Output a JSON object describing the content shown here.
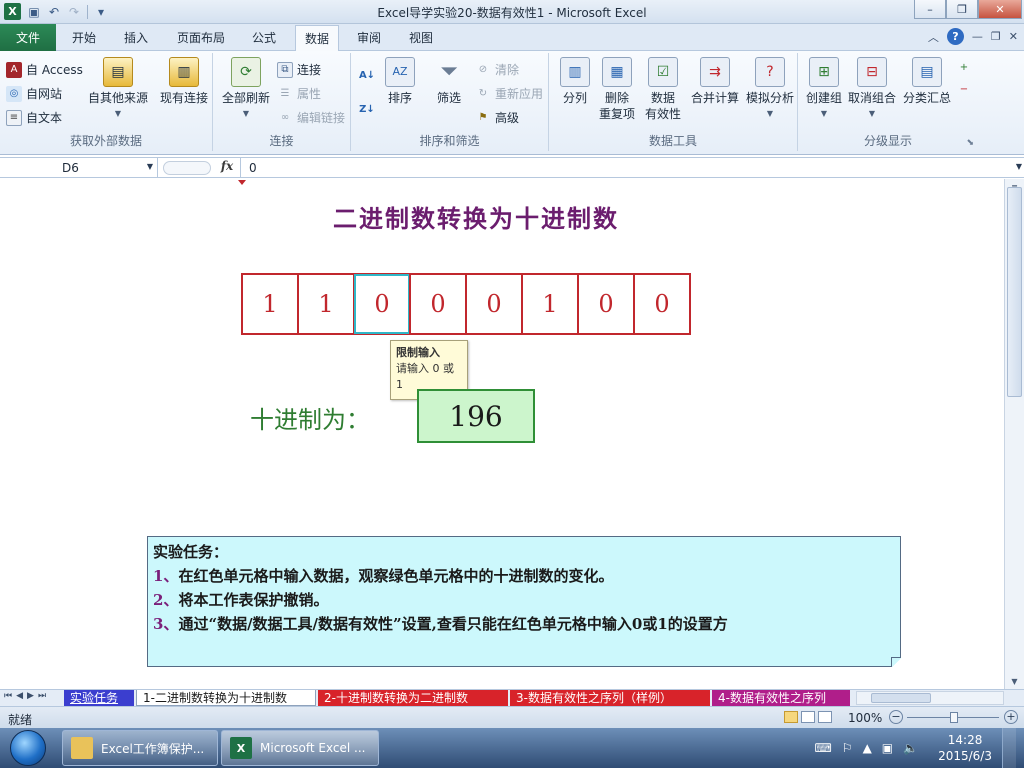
{
  "window": {
    "title": "Excel导学实验20-数据有效性1  -  Microsoft Excel",
    "controls": {
      "minimize": "–",
      "restore": "❐",
      "close": "✕"
    }
  },
  "qat": {
    "logo": "X",
    "save": "▣",
    "undo": "↶",
    "redo": "↷",
    "customize": "▾"
  },
  "tabs": {
    "file": "文件",
    "items": [
      "开始",
      "插入",
      "页面布局",
      "公式",
      "数据",
      "审阅",
      "视图"
    ],
    "active": "数据"
  },
  "ribbon": {
    "external": {
      "label": "获取外部数据",
      "access": "自 Access",
      "web": "自网站",
      "text": "自文本",
      "other": "自其他来源",
      "existing": "现有连接"
    },
    "connections": {
      "label": "连接",
      "refresh_all": "全部刷新",
      "connect": "连接",
      "properties": "属性",
      "edit_links": "编辑链接"
    },
    "sort_filter": {
      "label": "排序和筛选",
      "sort": "排序",
      "filter": "筛选",
      "clear": "清除",
      "reapply": "重新应用",
      "advanced": "高级"
    },
    "data_tools": {
      "label": "数据工具",
      "text_to_columns": "分列",
      "remove_dup_1": "删除",
      "remove_dup_2": "重复项",
      "validation_1": "数据",
      "validation_2": "有效性",
      "consolidate": "合并计算",
      "what_if": "模拟分析"
    },
    "outline": {
      "label": "分级显示",
      "group": "创建组",
      "ungroup": "取消组合",
      "subtotal": "分类汇总"
    }
  },
  "formula_bar": {
    "name_box": "D6",
    "fx": "fx",
    "value": "0"
  },
  "sheet": {
    "title": "二进制数转换为十进制数",
    "bits": [
      "1",
      "1",
      "0",
      "0",
      "0",
      "1",
      "0",
      "0"
    ],
    "selected_index": 2,
    "tooltip": {
      "title": "限制输入",
      "line1": "请输入 0 或",
      "line2": "1"
    },
    "decimal_label": "十进制为：",
    "decimal_value": "196",
    "task": {
      "heading": "实验任务：",
      "items": [
        {
          "num": "1、",
          "text": "在红色单元格中输入数据，观察绿色单元格中的十进制数的变化。"
        },
        {
          "num": "2、",
          "text": "将本工作表保护撤销。"
        },
        {
          "num": "3、",
          "text": "通过“数据/数据工具/数据有效性”设置,查看只能在红色单元格中输入0或1的设置方"
        }
      ]
    }
  },
  "sheet_tabs": [
    "实验任务",
    "1-二进制数转换为十进制数",
    "2-十进制数转换为二进制数",
    "3-数据有效性之序列（样例）",
    "4-数据有效性之序列"
  ],
  "status": {
    "ready": "就绪",
    "zoom": "100%"
  },
  "taskbar": {
    "items": [
      "Excel工作簿保护...",
      "Microsoft Excel ..."
    ],
    "time": "14:28",
    "date": "2015/6/3"
  },
  "colors": {
    "excel_green": "#1e7145",
    "bit_red": "#c1272d",
    "decimal_green": "#2f7d32",
    "title_purple": "#6b1d6e",
    "task_bg": "#ccf8fc"
  }
}
